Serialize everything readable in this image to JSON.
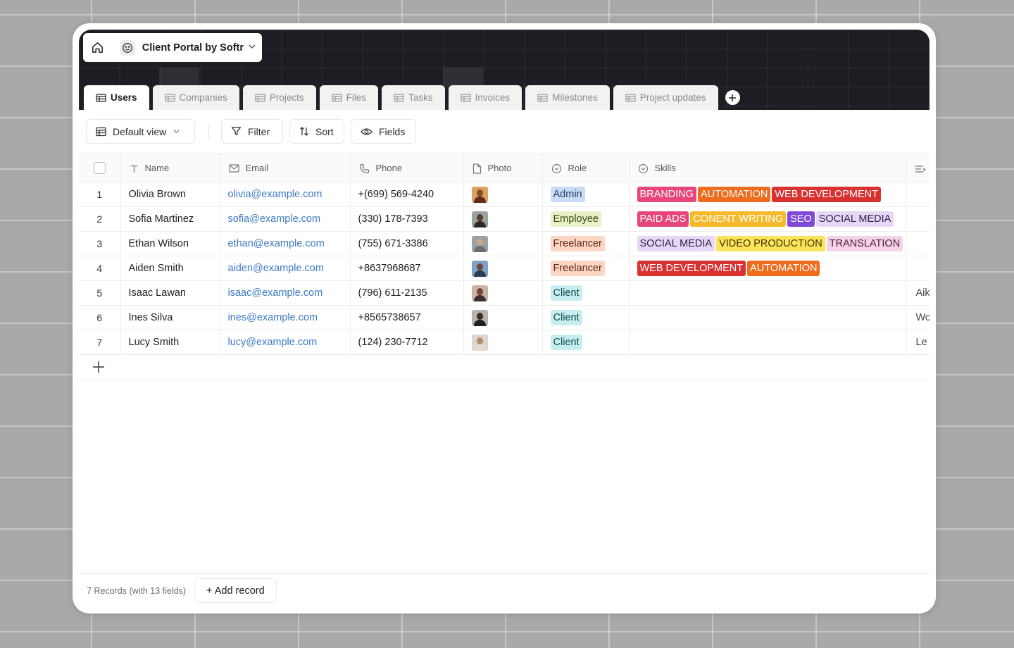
{
  "base": {
    "name": "Client Portal by Softr"
  },
  "tabs": [
    {
      "label": "Users",
      "active": true
    },
    {
      "label": "Companies"
    },
    {
      "label": "Projects"
    },
    {
      "label": "Files"
    },
    {
      "label": "Tasks"
    },
    {
      "label": "Invoices"
    },
    {
      "label": "Milestones"
    },
    {
      "label": "Project updates"
    }
  ],
  "toolbar": {
    "view_label": "Default view",
    "filter_label": "Filter",
    "sort_label": "Sort",
    "fields_label": "Fields"
  },
  "columns": {
    "name": "Name",
    "email": "Email",
    "phone": "Phone",
    "photo": "Photo",
    "role": "Role",
    "skills": "Skills"
  },
  "rows": [
    {
      "num": "1",
      "name": "Olivia Brown",
      "email": "olivia@example.com",
      "phone": "+(699) 569-4240",
      "role": "Admin",
      "skills": [
        "BRANDING",
        "AUTOMATION",
        "WEB DEVELOPMENT"
      ],
      "extra": ""
    },
    {
      "num": "2",
      "name": "Sofia Martinez",
      "email": "sofia@example.com",
      "phone": "(330) 178-7393",
      "role": "Employee",
      "skills": [
        "PAID ADS",
        "CONENT WRITING",
        "SEO",
        "SOCIAL MEDIA"
      ],
      "extra": ""
    },
    {
      "num": "3",
      "name": "Ethan Wilson",
      "email": "ethan@example.com",
      "phone": "(755) 671-3386",
      "role": "Freelancer",
      "skills": [
        "SOCIAL MEDIA",
        "VIDEO PRODUCTION",
        "TRANSLATION"
      ],
      "extra": ""
    },
    {
      "num": "4",
      "name": "Aiden Smith",
      "email": "aiden@example.com",
      "phone": "+8637968687",
      "role": "Freelancer",
      "skills": [
        "WEB DEVELOPMENT",
        "AUTOMATION"
      ],
      "extra": ""
    },
    {
      "num": "5",
      "name": "Isaac Lawan",
      "email": "isaac@example.com",
      "phone": "(796) 611-2135",
      "role": "Client",
      "skills": [],
      "extra": "Aik"
    },
    {
      "num": "6",
      "name": "Ines Silva",
      "email": "ines@example.com",
      "phone": "+8565738657",
      "role": "Client",
      "skills": [],
      "extra": "Wo"
    },
    {
      "num": "7",
      "name": "Lucy Smith",
      "email": "lucy@example.com",
      "phone": "(124) 230-7712",
      "role": "Client",
      "skills": [],
      "extra": "Le"
    }
  ],
  "role_colors": {
    "Admin": {
      "bg": "#c9dcf7",
      "fg": "#1f3f66"
    },
    "Employee": {
      "bg": "#e6f2c6",
      "fg": "#3a4a12"
    },
    "Freelancer": {
      "bg": "#fcd5c4",
      "fg": "#5e2a14"
    },
    "Client": {
      "bg": "#c6eef0",
      "fg": "#174a4e"
    }
  },
  "skill_colors": {
    "BRANDING": {
      "bg": "#e8457a",
      "fg": "#ffffff"
    },
    "AUTOMATION": {
      "bg": "#ef6c1f",
      "fg": "#ffffff"
    },
    "WEB DEVELOPMENT": {
      "bg": "#d93030",
      "fg": "#ffffff"
    },
    "PAID ADS": {
      "bg": "#e8457a",
      "fg": "#ffffff"
    },
    "CONENT WRITING": {
      "bg": "#f6b92b",
      "fg": "#ffffff"
    },
    "SEO": {
      "bg": "#7f4ad6",
      "fg": "#ffffff"
    },
    "SOCIAL MEDIA": {
      "bg": "#e6d7f7",
      "fg": "#2e1f47"
    },
    "VIDEO PRODUCTION": {
      "bg": "#fbe35a",
      "fg": "#3f3600"
    },
    "TRANSLATION": {
      "bg": "#f5d2e6",
      "fg": "#4b1d36"
    }
  },
  "avatar_colors": [
    {
      "bg": "#d9a35f",
      "skin": "#8a4a2a",
      "cloth": "#5a2f1c"
    },
    {
      "bg": "#9aa39b",
      "skin": "#5a3a2e",
      "cloth": "#2a2a2a"
    },
    {
      "bg": "#9aa0a6",
      "skin": "#c9a58a",
      "cloth": "#6b6f74"
    },
    {
      "bg": "#7da2c6",
      "skin": "#6e4a3a",
      "cloth": "#2d3b52"
    },
    {
      "bg": "#c8b4a6",
      "skin": "#7a4432",
      "cloth": "#3a2f2a"
    },
    {
      "bg": "#b9b2aa",
      "skin": "#3a2a24",
      "cloth": "#1f1f1f"
    },
    {
      "bg": "#dcd6cf",
      "skin": "#b98a6e",
      "cloth": "#e3ddd4"
    }
  ],
  "footer": {
    "count": "7 Records (with 13 fields)",
    "add_record": "+ Add record"
  }
}
